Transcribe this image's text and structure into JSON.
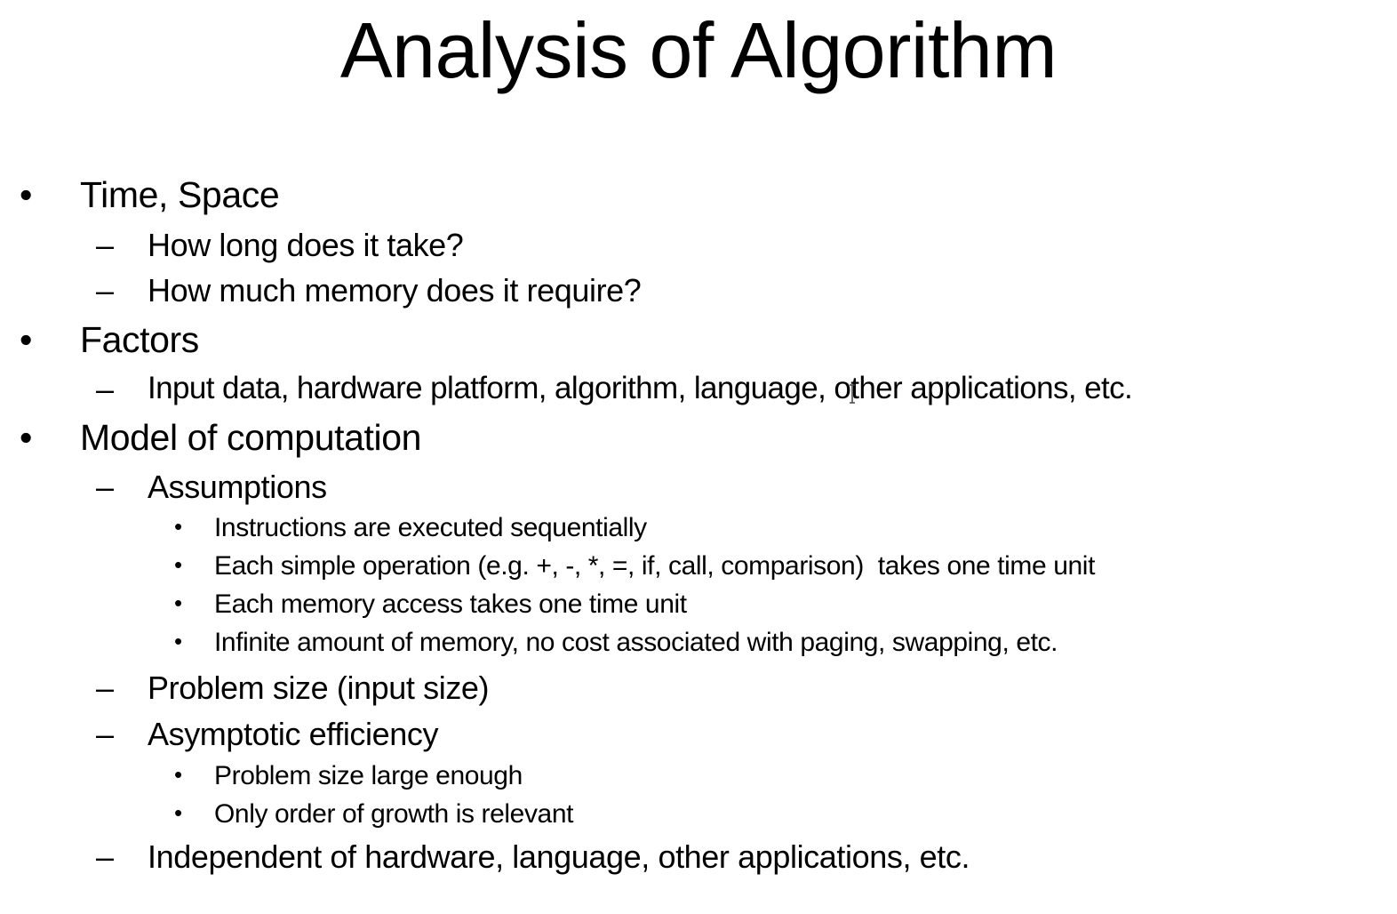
{
  "slide": {
    "title": "Analysis of Algorithm",
    "level1_marker": "•",
    "level2_marker": "–",
    "level3_marker": "•",
    "items": [
      {
        "text": "Time, Space"
      },
      {
        "text": "How long does it take?"
      },
      {
        "text": "How much memory does it require?"
      },
      {
        "text": "Factors"
      },
      {
        "text": "Input data, hardware platform, algorithm, language, other applications, etc."
      },
      {
        "text": "Model of computation"
      },
      {
        "text": "Assumptions"
      },
      {
        "text": "Instructions are executed sequentially"
      },
      {
        "text": "Each simple operation (e.g. +, -, *, =, if, call, comparison)  takes one time unit"
      },
      {
        "text": "Each memory access takes one time unit"
      },
      {
        "text": "Infinite amount of memory, no cost associated with paging, swapping, etc."
      },
      {
        "text": "Problem size (input size)"
      },
      {
        "text": "Asymptotic efficiency"
      },
      {
        "text": "Problem size large enough"
      },
      {
        "text": "Only order of growth is relevant"
      },
      {
        "text": "Independent of hardware, language, other applications, etc."
      }
    ]
  }
}
